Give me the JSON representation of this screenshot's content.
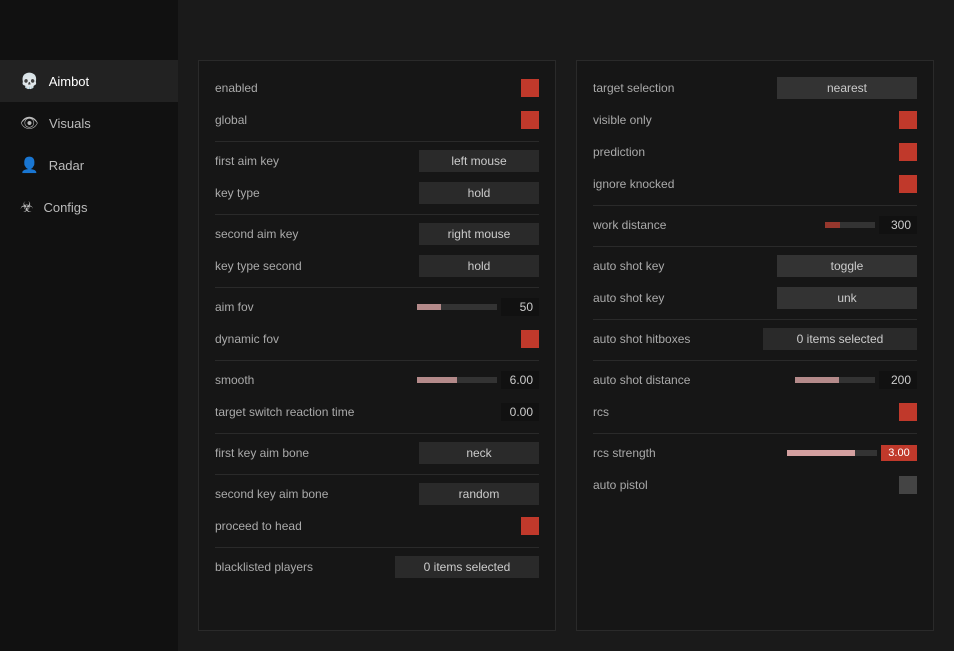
{
  "sidebar": {
    "items": [
      {
        "label": "Aimbot",
        "icon": "💀",
        "active": true
      },
      {
        "label": "Visuals",
        "icon": "👁",
        "active": false
      },
      {
        "label": "Radar",
        "icon": "👤",
        "active": false
      },
      {
        "label": "Configs",
        "icon": "☣",
        "active": false
      }
    ]
  },
  "left_panel": {
    "enabled_label": "enabled",
    "global_label": "global",
    "first_aim_key_label": "first aim key",
    "first_aim_key_value": "left mouse",
    "key_type_label": "key type",
    "key_type_value": "hold",
    "second_aim_key_label": "second aim key",
    "second_aim_key_value": "right mouse",
    "key_type_second_label": "key type second",
    "key_type_second_value": "hold",
    "aim_fov_label": "aim fov",
    "aim_fov_value": "50",
    "dynamic_fov_label": "dynamic fov",
    "smooth_label": "smooth",
    "smooth_value": "6.00",
    "target_switch_label": "target switch reaction time",
    "target_switch_value": "0.00",
    "first_key_aim_bone_label": "first key aim bone",
    "first_key_aim_bone_value": "neck",
    "second_key_aim_bone_label": "second key aim bone",
    "second_key_aim_bone_value": "random",
    "proceed_to_head_label": "proceed to head",
    "blacklisted_players_label": "blacklisted players",
    "blacklisted_players_value": "0 items selected"
  },
  "right_panel": {
    "target_selection_label": "target selection",
    "target_selection_value": "nearest",
    "visible_only_label": "visible only",
    "prediction_label": "prediction",
    "ignore_knocked_label": "ignore knocked",
    "work_distance_label": "work distance",
    "work_distance_value": "300",
    "auto_shot_key_label": "auto shot key",
    "auto_shot_key_value": "toggle",
    "auto_shot_key2_label": "auto shot key",
    "auto_shot_key2_value": "unk",
    "auto_shot_hitboxes_label": "auto shot hitboxes",
    "auto_shot_hitboxes_value": "0 items selected",
    "auto_shot_distance_label": "auto shot distance",
    "auto_shot_distance_value": "200",
    "rcs_label": "rcs",
    "rcs_strength_label": "rcs strength",
    "rcs_strength_value": "3.00",
    "auto_pistol_label": "auto pistol"
  }
}
